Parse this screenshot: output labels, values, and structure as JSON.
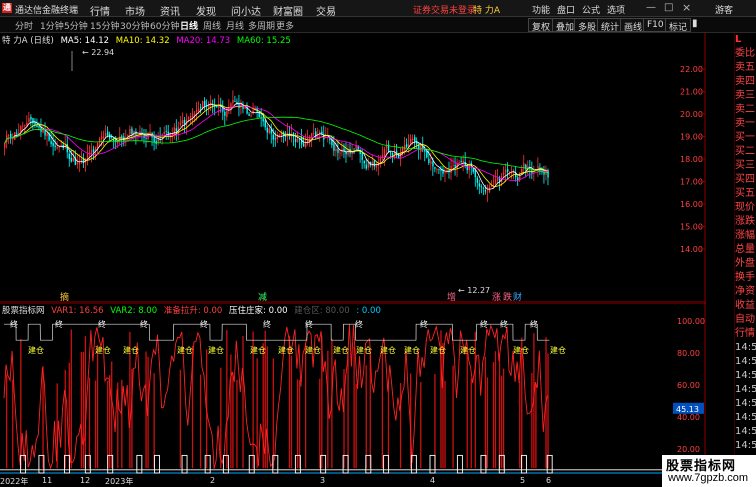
{
  "titlebar": {
    "app_title": "通达信金融终端",
    "menus": [
      "行情",
      "市场",
      "资讯",
      "发现",
      "问小达",
      "财富圈",
      "交易"
    ],
    "status": "证券交易未登录",
    "stock": "特 力A",
    "right_items": [
      "功能",
      "盘口",
      "公式",
      "选项"
    ],
    "guest": "游客"
  },
  "toolbar": {
    "periods": [
      "分时",
      "1分钟",
      "5分钟",
      "15分钟",
      "30分钟",
      "60分钟",
      "日线",
      "周线",
      "月线",
      "多周期",
      "更多"
    ],
    "active_period": "日线",
    "buttons": [
      "复权",
      "叠加",
      "多股",
      "统计",
      "画线",
      "F10",
      "标记"
    ]
  },
  "main_legend": {
    "stock_label": "特 力A (日线)",
    "ma5": "MA5: 14.12",
    "ma10": "MA10: 14.32",
    "ma20": "MA20: 14.73",
    "ma60": "MA60: 15.25",
    "colors": {
      "ma5": "#ffffff",
      "ma10": "#ffff00",
      "ma20": "#ff00ff",
      "ma60": "#00ff00",
      "up": "#ff3333",
      "down": "#00ffff"
    }
  },
  "price_axis": [
    "22.00",
    "21.00",
    "20.00",
    "19.00",
    "18.00",
    "17.00",
    "16.00",
    "15.00",
    "14.00"
  ],
  "annotations": {
    "high": "22.94",
    "low": "12.27",
    "markers": [
      "摘",
      "减",
      "增",
      "涨",
      "跌",
      "财"
    ]
  },
  "ind_legend": {
    "name": "股票指标网",
    "var1": "VAR1: 16.56",
    "var2": "VAR2: 8.00",
    "zhunbei": "准备拉升: 0.00",
    "yazhu": "压住庄家: 0.00",
    "jiancang": "建仓区: 80.00",
    "last": ": 0.00"
  },
  "ind_axis": [
    "100.00",
    "80.00",
    "60.00",
    "40.00",
    "20.00"
  ],
  "ind_current": "45.13",
  "ind_labels": {
    "jian": "建仓",
    "zhong": "终"
  },
  "sidepanel": {
    "head": "L",
    "items": [
      "委比",
      "卖五",
      "卖四",
      "卖三",
      "卖二",
      "卖一",
      "买一",
      "买二",
      "买三",
      "买四",
      "买五",
      "现价",
      "涨跌",
      "涨幅",
      "总量",
      "外盘",
      "换手",
      "净资",
      "收益"
    ],
    "items2": [
      "自动",
      "行情"
    ],
    "times": [
      "14:5",
      "14:5",
      "14:5",
      "14:5",
      "14:5",
      "14:5",
      "14:5",
      "14:5",
      "14:5",
      "14:5"
    ]
  },
  "date_axis": [
    "2022年",
    "11",
    "12",
    "2023年",
    "2",
    "3",
    "4",
    "5",
    "6"
  ],
  "watermark": {
    "line1": "股票指标网",
    "line2": "www.7gpzb.com"
  }
}
